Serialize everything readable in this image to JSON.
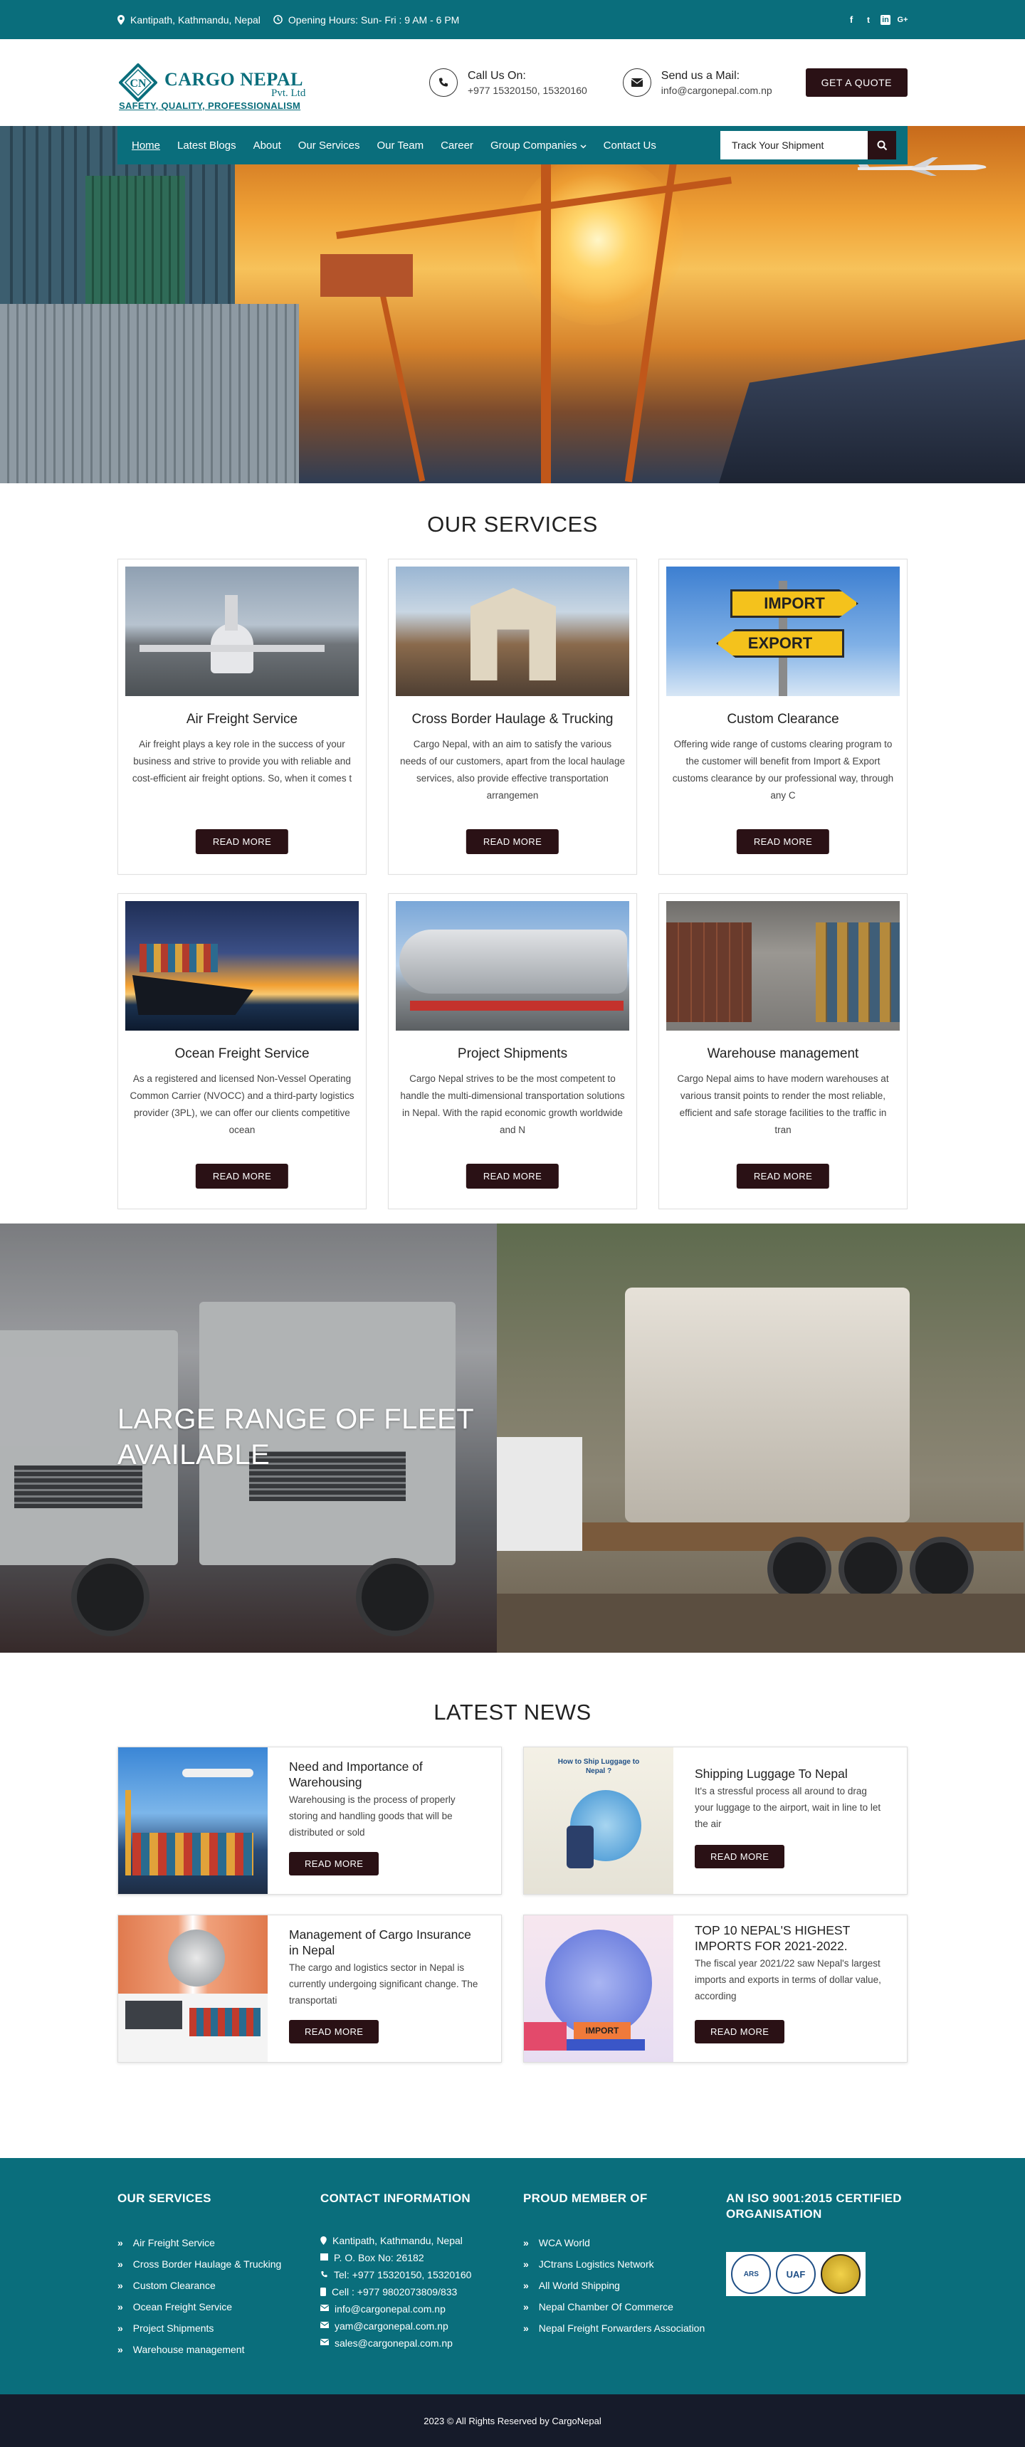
{
  "topbar": {
    "address": "Kantipath, Kathmandu, Nepal",
    "hours": "Opening Hours: Sun- Fri : 9 AM - 6 PM",
    "social_icons": [
      "facebook-icon",
      "twitter-icon",
      "linkedin-icon",
      "google-plus-icon"
    ],
    "social_labels": [
      "f",
      "t",
      "in",
      "G+"
    ]
  },
  "header": {
    "logo_initials": "CN",
    "logo_name": "CARGO NEPAL",
    "logo_pvt": "Pvt. Ltd",
    "tagline": "SAFETY, QUALITY, PROFESSIONALISM",
    "call_title": "Call Us On:",
    "call_value": "+977 15320150, 15320160",
    "mail_title": "Send us a Mail:",
    "mail_value": "info@cargonepal.com.np",
    "quote_label": "GET A QUOTE"
  },
  "nav": {
    "items": [
      "Home",
      "Latest Blogs",
      "About",
      "Our Services",
      "Our Team",
      "Career",
      "Group Companies",
      "Contact Us"
    ],
    "track_value": "Track Your Shipment"
  },
  "services": {
    "title": "OUR SERVICES",
    "read_more": "READ MORE",
    "items": [
      {
        "title": "Air Freight Service",
        "text": "Air freight plays a key role in the success of your business and strive to provide you with reliable and cost-efficient air freight options. So, when it comes t"
      },
      {
        "title": "Cross Border Haulage & Trucking",
        "text": "Cargo Nepal, with an aim to satisfy the various needs of our customers, apart from the local haulage services, also provide effective transportation arrangemen"
      },
      {
        "title": "Custom Clearance",
        "text": "Offering wide range of customs clearing program to the customer will benefit from Import & Export customs clearance by our professional way, through any C"
      },
      {
        "title": "Ocean Freight Service",
        "text": "As a registered and licensed Non-Vessel Operating Common Carrier (NVOCC) and a third-party logistics provider (3PL), we can offer our clients competitive ocean"
      },
      {
        "title": "Project Shipments",
        "text": "Cargo Nepal strives to be the most competent to handle the multi-dimensional transportation solutions in Nepal. With the rapid economic growth worldwide and N"
      },
      {
        "title": "Warehouse management",
        "text": "Cargo Nepal aims to have modern warehouses at various transit points to render the most reliable, efficient and safe storage facilities to the traffic in tran"
      }
    ],
    "sign_import": "IMPORT",
    "sign_export": "EXPORT"
  },
  "fleet": {
    "title_line1": "LARGE RANGE OF FLEET",
    "title_line2": "AVAILABLE"
  },
  "news": {
    "title": "LATEST NEWS",
    "read_more": "READ MORE",
    "items": [
      {
        "title": "Need and Importance of Warehousing",
        "text": "Warehousing is the process of properly storing and handling goods that will be distributed or sold"
      },
      {
        "title": "Shipping Luggage To Nepal",
        "text": "It's a stressful process all around to drag your luggage to the airport, wait in line to let the air",
        "img_caption": "How to Ship Luggage to Nepal ?"
      },
      {
        "title": "Management of Cargo Insurance in Nepal",
        "text": "The cargo and logistics sector in Nepal is currently undergoing significant change. The transportati"
      },
      {
        "title": "TOP 10 NEPAL'S HIGHEST IMPORTS FOR 2021-2022.",
        "text": "The fiscal year 2021/22 saw Nepal's largest imports and exports in terms of dollar value, according",
        "img_label": "IMPORT"
      }
    ]
  },
  "footer": {
    "services_title": "OUR SERVICES",
    "services": [
      "Air Freight Service",
      "Cross Border Haulage & Trucking",
      "Custom Clearance",
      "Ocean Freight Service",
      "Project Shipments",
      "Warehouse management"
    ],
    "contact_title": "CONTACT INFORMATION",
    "contact": [
      "Kantipath, Kathmandu, Nepal",
      "P. O. Box No: 26182",
      "Tel: +977 15320150, 15320160",
      "Cell : +977 9802073809/833",
      "info@cargonepal.com.np",
      "yam@cargonepal.com.np",
      "sales@cargonepal.com.np"
    ],
    "member_title": "PROUD MEMBER OF",
    "members": [
      "WCA World",
      "JCtrans Logistics Network",
      "All World Shipping",
      "Nepal Chamber Of Commerce",
      "Nepal Freight Forwarders Association"
    ],
    "iso_title": "AN ISO 9001:2015 CERTIFIED ORGANISATION",
    "cert_labels": [
      "ARS",
      "UAF",
      ""
    ],
    "copyright": "2023 © All Rights Reserved by CargoNepal"
  },
  "colors": {
    "primary": "#0a6e7c",
    "dark": "#2a1115",
    "footer_bottom": "#161b2a"
  }
}
